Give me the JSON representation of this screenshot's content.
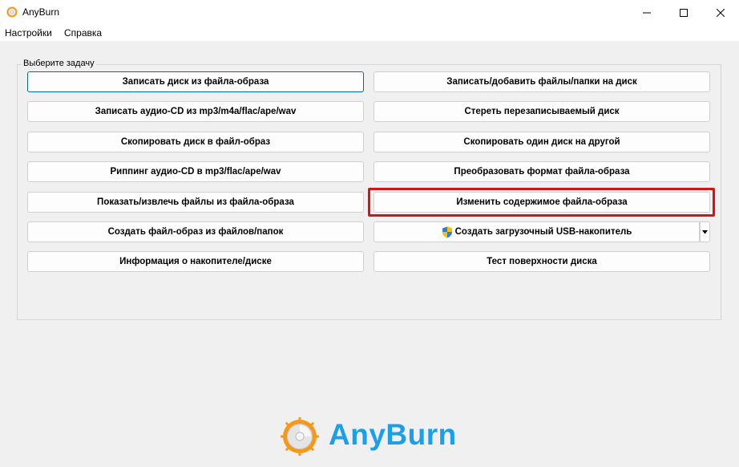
{
  "window": {
    "title": "AnyBurn",
    "icon": "anyburn-disc-icon",
    "controls": [
      "minimize-icon",
      "maximize-icon",
      "close-icon"
    ]
  },
  "menu": {
    "settings": "Настройки",
    "help": "Справка"
  },
  "group": {
    "title": "Выберите задачу"
  },
  "tasks": {
    "left": [
      "Записать диск из файла-образа",
      "Записать аудио-CD из mp3/m4a/flac/ape/wav",
      "Скопировать диск в файл-образ",
      "Риппинг аудио-CD в mp3/flac/ape/wav",
      "Показать/извлечь файлы из файла-образа",
      "Создать файл-образ из файлов/папок",
      "Информация о накопителе/диске"
    ],
    "right": [
      "Записать/добавить файлы/папки на диск",
      "Стереть перезаписываемый диск",
      "Скопировать один диск на другой",
      "Преобразовать формат файла-образа",
      "Изменить содержимое файла-образа",
      "Создать загрузочный USB-накопитель",
      "Тест поверхности диска"
    ],
    "highlighted": "Изменить содержимое файла-образа",
    "usb_icon": "uac-shield-icon",
    "usb_dropdown_icon": "triangle-down-icon"
  },
  "branding": {
    "logo_text": "AnyBurn",
    "logo_icon": "anyburn-disc-logo",
    "accent_color": "#1e9ee6",
    "highlight_color": "#d6121b"
  }
}
